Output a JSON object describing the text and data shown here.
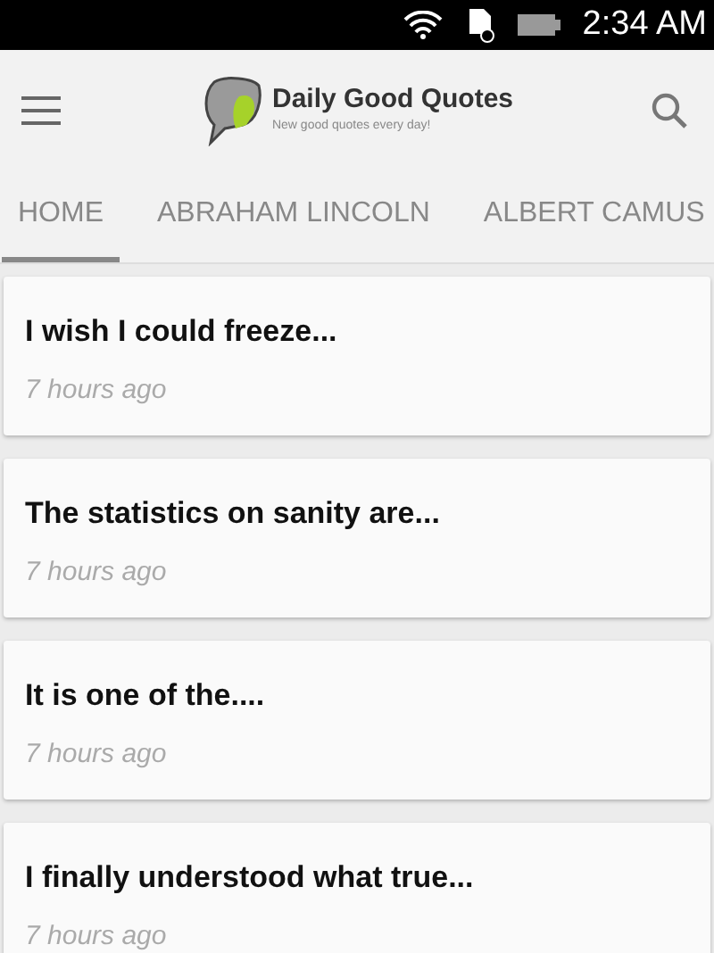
{
  "status_bar": {
    "time": "2:34 AM"
  },
  "app_bar": {
    "title": "Daily Good Quotes",
    "tagline": "New good quotes every day!"
  },
  "tabs": [
    {
      "label": "HOME",
      "selected": true
    },
    {
      "label": "ABRAHAM LINCOLN",
      "selected": false
    },
    {
      "label": "ALBERT CAMUS",
      "selected": false
    }
  ],
  "posts": [
    {
      "title": "I wish I could freeze...",
      "time": "7 hours ago"
    },
    {
      "title": "The statistics on sanity are...",
      "time": "7 hours ago"
    },
    {
      "title": "It is one of the....",
      "time": "7 hours ago"
    },
    {
      "title": "I finally understood what true...",
      "time": "7 hours ago"
    }
  ]
}
